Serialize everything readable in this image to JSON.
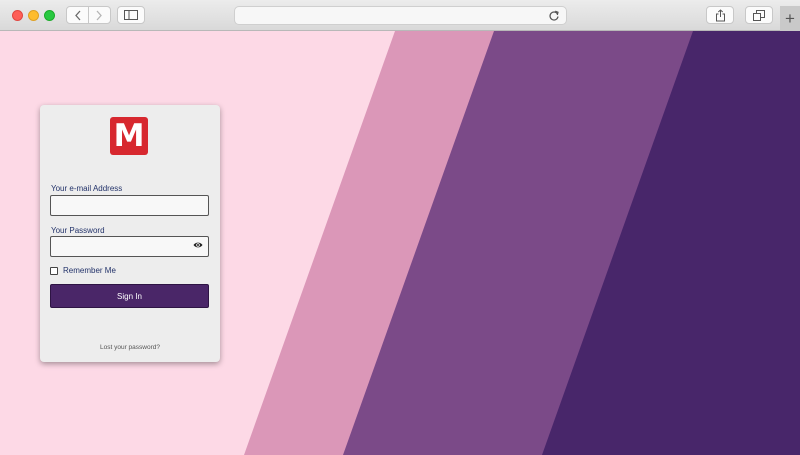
{
  "browser": {
    "icons": {
      "back": "chevron-left-icon",
      "forward": "chevron-right-icon",
      "sidebar": "sidebar-icon",
      "reload": "reload-icon",
      "share": "share-icon",
      "tabs": "tabs-icon",
      "new_tab": "plus-icon"
    },
    "new_tab_glyph": "+"
  },
  "colors": {
    "background": "#fdd9e6",
    "stripe_pink": "#db97b8",
    "stripe_violet": "#7b4a88",
    "stripe_dark": "#48266a",
    "brand_red": "#d7282f",
    "button_purple": "#4a2668",
    "label_blue": "#23336a"
  },
  "login": {
    "logo_letter": "M",
    "email_label": "Your e-mail Address",
    "email_value": "",
    "password_label": "Your Password",
    "password_value": "",
    "password_icon": "eye-icon",
    "remember_label": "Remember Me",
    "remember_checked": false,
    "signin_label": "Sign In",
    "lost_password_link": "Lost your password?"
  }
}
